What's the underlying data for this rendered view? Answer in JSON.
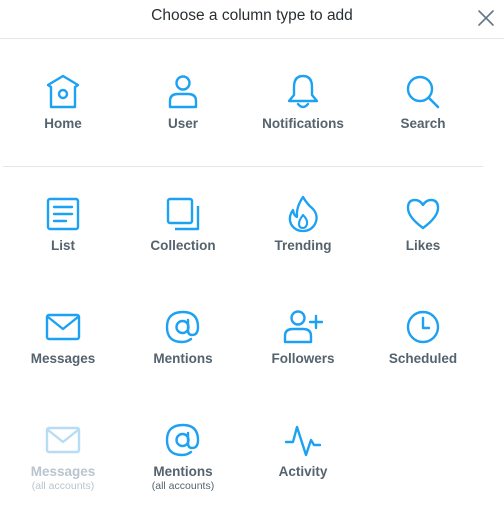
{
  "header": {
    "title": "Choose a column type to add",
    "close_icon": "close-icon"
  },
  "colors": {
    "accent": "#1da1f2",
    "disabled": "#b7dcf5",
    "label": "#55636e",
    "disabled_label": "#b9c5ce"
  },
  "columns": {
    "home": {
      "label": "Home",
      "icon": "home-icon"
    },
    "user": {
      "label": "User",
      "icon": "user-icon"
    },
    "notifications": {
      "label": "Notifications",
      "icon": "bell-icon"
    },
    "search": {
      "label": "Search",
      "icon": "search-icon"
    },
    "list": {
      "label": "List",
      "icon": "list-icon"
    },
    "collection": {
      "label": "Collection",
      "icon": "collection-icon"
    },
    "trending": {
      "label": "Trending",
      "icon": "flame-icon"
    },
    "likes": {
      "label": "Likes",
      "icon": "heart-icon"
    },
    "messages": {
      "label": "Messages",
      "icon": "envelope-icon"
    },
    "mentions": {
      "label": "Mentions",
      "icon": "at-icon"
    },
    "followers": {
      "label": "Followers",
      "icon": "add-user-icon"
    },
    "scheduled": {
      "label": "Scheduled",
      "icon": "clock-icon"
    },
    "messages_all": {
      "label": "Messages",
      "sub": "(all accounts)",
      "icon": "envelope-icon",
      "disabled": true
    },
    "mentions_all": {
      "label": "Mentions",
      "sub": "(all accounts)",
      "icon": "at-icon"
    },
    "activity": {
      "label": "Activity",
      "icon": "activity-icon"
    }
  }
}
